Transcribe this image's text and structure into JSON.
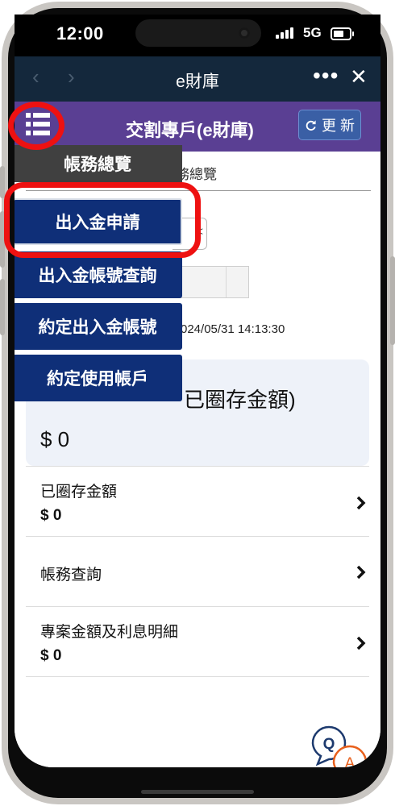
{
  "status_bar": {
    "time": "12:00",
    "network": "5G"
  },
  "browser": {
    "title": "e財庫",
    "back_icon": "chevron-left-icon",
    "forward_icon": "chevron-right-icon",
    "more_icon": "more-dots-icon",
    "close_icon": "close-icon"
  },
  "app_header": {
    "title": "交割專戶(e財庫)",
    "menu_icon": "list-menu-icon",
    "refresh_label": "更 新"
  },
  "page": {
    "breadcrumb": "務總覽",
    "select_arrow": "<",
    "timestamp": "024/05/31 14:13:30"
  },
  "summary_card": {
    "title": "已圈存金額)",
    "amount": "$ 0"
  },
  "list": [
    {
      "label": "已圈存金額",
      "value": "$ 0"
    },
    {
      "label": "帳務查詢",
      "value": ""
    },
    {
      "label": "專案金額及利息明細",
      "value": "$ 0"
    }
  ],
  "dropdown": {
    "items": [
      "帳務總覽",
      "出入金申請",
      "出入金帳號查詢",
      "約定出入金帳號",
      "約定使用帳戶"
    ]
  },
  "qa_button": {
    "q": "Q",
    "a": "A"
  },
  "colors": {
    "header_purple": "#5a3f93",
    "browser_bar": "#14283c",
    "menu_navy": "#0f2f78",
    "highlight_red": "#ee1111",
    "qa_orange": "#e8601c",
    "qa_navy": "#1d3a6e"
  }
}
